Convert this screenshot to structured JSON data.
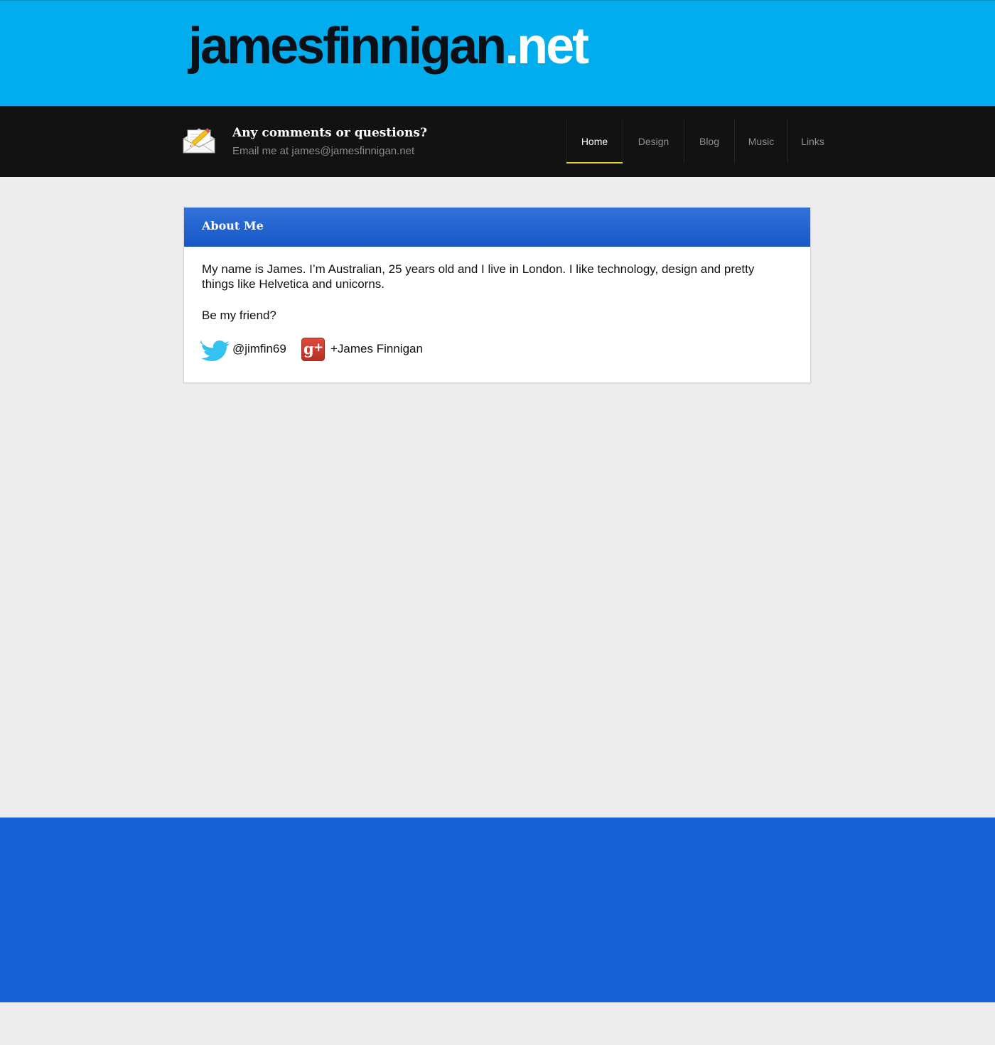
{
  "header": {
    "site_name": "jamesfinnigan",
    "site_tld": ".net"
  },
  "contact": {
    "icon": "mail-edit-icon",
    "title": "Any comments or questions?",
    "subtitle": "Email me at james@jamesfinnigan.net"
  },
  "nav": {
    "items": [
      {
        "label": "Home",
        "active": true
      },
      {
        "label": "Design",
        "active": false
      },
      {
        "label": "Blog",
        "active": false
      },
      {
        "label": "Music",
        "active": false
      },
      {
        "label": "Links",
        "active": false
      }
    ]
  },
  "about": {
    "title": "About Me",
    "intro": "My name is James. I’m Australian, 25 years old and I live in London. I like technology, design and pretty things like Helvetica and unicorns.",
    "question": "Be my friend?",
    "twitter": {
      "icon": "twitter-bird-icon",
      "handle": "@jimfin69"
    },
    "gplus": {
      "icon": "google-plus-icon",
      "name": "+James Finnigan"
    }
  },
  "colors": {
    "header_bg": "#02adee",
    "bar_bg": "#121212",
    "card_header": "#1757c8",
    "footer_bg": "#1560d6",
    "nav_active_underline": "#e8d219"
  }
}
